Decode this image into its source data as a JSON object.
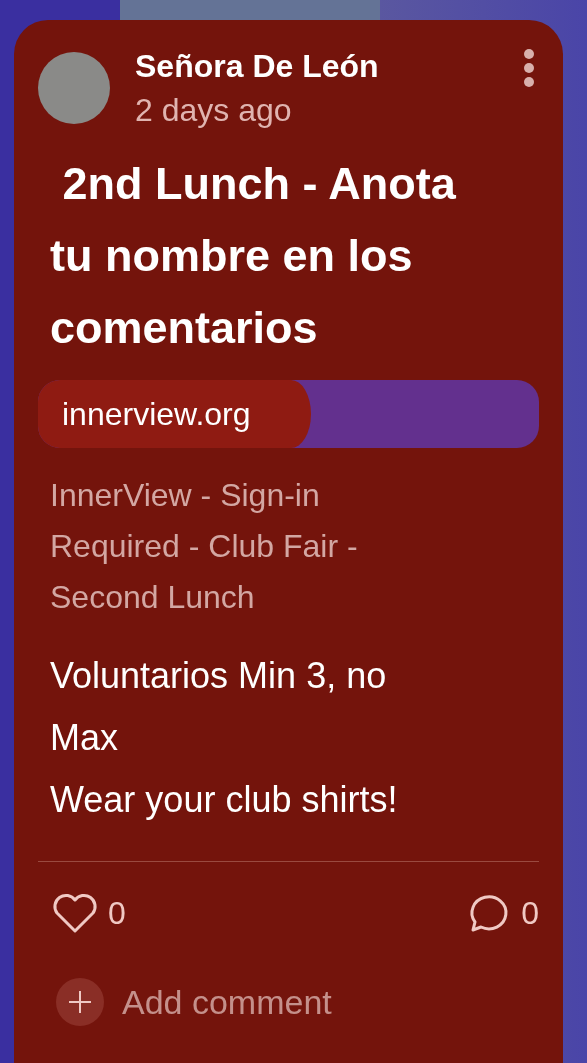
{
  "post": {
    "author": "Señora De León",
    "time": "2 days ago",
    "title": " 2nd Lunch - Anota tu nombre en los comentarios",
    "link": {
      "domain": "innerview.org",
      "description": "InnerView - Sign-in Required - Club Fair - Second Lunch"
    },
    "body": [
      "Voluntarios Min 3, no Max",
      "Wear your club shirts!"
    ],
    "likes": "0",
    "comments": "0",
    "add_comment": "Add comment"
  }
}
